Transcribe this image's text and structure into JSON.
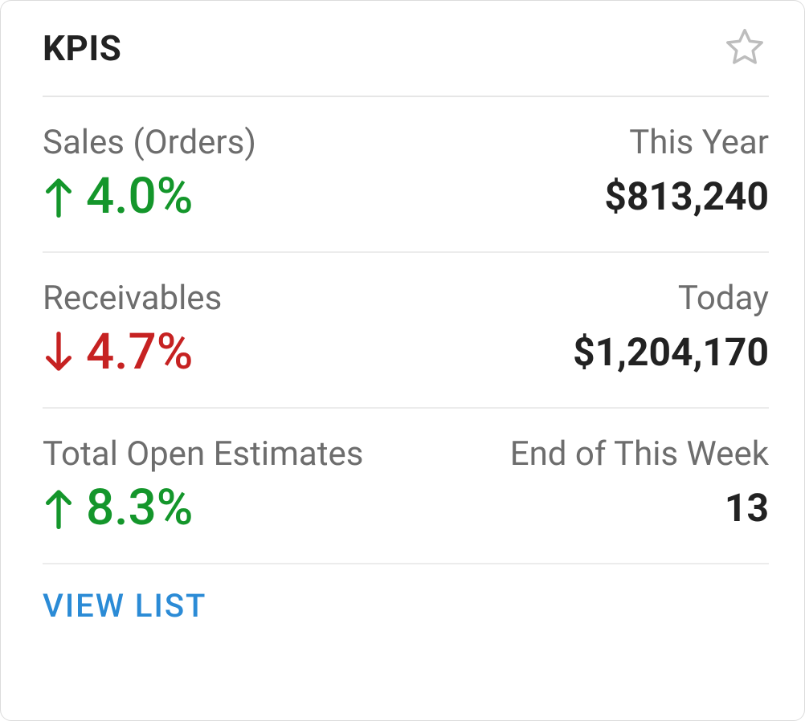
{
  "header": {
    "title": "KPIS"
  },
  "rows": [
    {
      "label": "Sales (Orders)",
      "period": "This Year",
      "direction": "up",
      "change": "4.0%",
      "value": "$813,240"
    },
    {
      "label": "Receivables",
      "period": "Today",
      "direction": "down",
      "change": "4.7%",
      "value": "$1,204,170"
    },
    {
      "label": "Total Open Estimates",
      "period": "End of This Week",
      "direction": "up",
      "change": "8.3%",
      "value": "13"
    }
  ],
  "footer": {
    "view_list_label": "VIEW LIST"
  },
  "colors": {
    "up": "#14962b",
    "down": "#c62222",
    "link": "#2b8bd6",
    "muted": "#6d6d6d"
  }
}
